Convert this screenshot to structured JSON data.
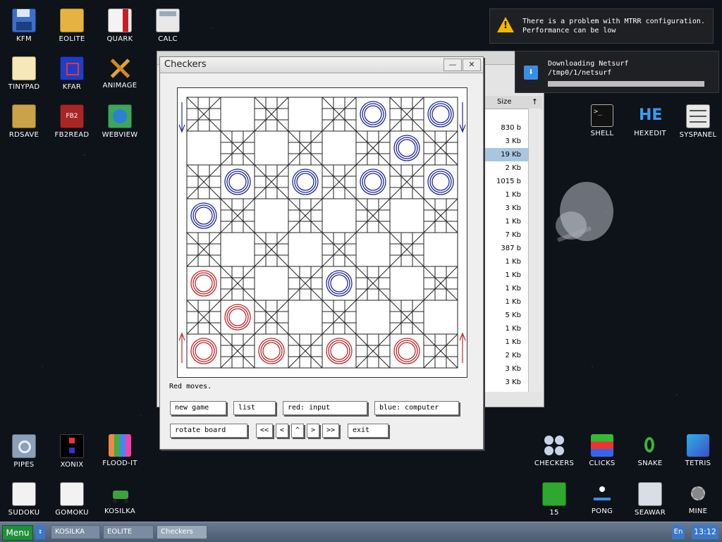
{
  "desktop": {
    "icons_left": [
      {
        "label": "KFM",
        "icon": "floppy-icon"
      },
      {
        "label": "EOLITE",
        "icon": "folder-icon"
      },
      {
        "label": "QUARK",
        "icon": "book-icon"
      },
      {
        "label": "CALC",
        "icon": "calculator-icon"
      },
      {
        "label": "TINYPAD",
        "icon": "notepad-icon"
      },
      {
        "label": "KFAR",
        "icon": "archive-icon"
      },
      {
        "label": "ANIMAGE",
        "icon": "paint-icon"
      },
      {
        "label": "RDSAVE",
        "icon": "disk-save-icon"
      },
      {
        "label": "FB2READ",
        "icon": "fb2-book-icon"
      },
      {
        "label": "WEBVIEW",
        "icon": "globe-icon"
      },
      {
        "label": "PIPES",
        "icon": "pipes-icon"
      },
      {
        "label": "XONIX",
        "icon": "xonix-icon"
      },
      {
        "label": "FLOOD-IT",
        "icon": "flood-icon"
      },
      {
        "label": "SUDOKU",
        "icon": "sudoku-icon"
      },
      {
        "label": "GOMOKU",
        "icon": "gomoku-icon"
      },
      {
        "label": "KOSILKA",
        "icon": "lawnmower-icon"
      }
    ],
    "icons_right": [
      {
        "label": "SHELL",
        "icon": "terminal-icon"
      },
      {
        "label": "HEXEDIT",
        "icon": "hex-icon"
      },
      {
        "label": "SYSPANEL",
        "icon": "sliders-icon"
      },
      {
        "label": "CHECKERS",
        "icon": "checkers-icon"
      },
      {
        "label": "CLICKS",
        "icon": "blocks-icon"
      },
      {
        "label": "SNAKE",
        "icon": "snake-icon"
      },
      {
        "label": "TETRIS",
        "icon": "tetris-icon"
      },
      {
        "label": "15",
        "icon": "fifteen-icon"
      },
      {
        "label": "PONG",
        "icon": "pong-icon"
      },
      {
        "label": "SEAWAR",
        "icon": "ship-icon"
      },
      {
        "label": "MINE",
        "icon": "mine-icon"
      }
    ]
  },
  "file_manager": {
    "size_header": "Size",
    "sizes": [
      "830 b",
      "3 Kb",
      "19 Kb",
      "2 Kb",
      "1015 b",
      "1 Kb",
      "3 Kb",
      "1 Kb",
      "7 Kb",
      "387 b",
      "1 Kb",
      "1 Kb",
      "1 Kb",
      "1 Kb",
      "5 Kb",
      "1 Kb",
      "1 Kb",
      "2 Kb",
      "3 Kb",
      "3 Kb"
    ],
    "selected_index": 2
  },
  "checkers": {
    "title": "Checkers",
    "status": "Red moves.",
    "buttons": {
      "new_game": "new game",
      "list": "list",
      "red": "red: input",
      "blue": "blue: computer",
      "rotate": "rotate board",
      "first": "<<",
      "prev": "<",
      "up": "^",
      "next": ">",
      "last": ">>",
      "exit": "exit"
    },
    "blue_pieces": [
      [
        0,
        5
      ],
      [
        0,
        7
      ],
      [
        1,
        6
      ],
      [
        2,
        1
      ],
      [
        2,
        3
      ],
      [
        2,
        5
      ],
      [
        2,
        7
      ],
      [
        3,
        0
      ],
      [
        5,
        4
      ]
    ],
    "red_pieces": [
      [
        5,
        0
      ],
      [
        6,
        1
      ],
      [
        7,
        0
      ],
      [
        7,
        2
      ],
      [
        7,
        4
      ],
      [
        7,
        6
      ]
    ],
    "colors": {
      "red": "#c0282a",
      "blue": "#1f2a9a",
      "grid": "#222222"
    }
  },
  "notifications": {
    "mtrr": {
      "line1": "There is a problem with MTRR configuration.",
      "line2": "Performance can be low"
    },
    "download": {
      "title": "Downloading Netsurf",
      "path": "/tmp0/1/netsurf",
      "progress": 0.0
    }
  },
  "taskbar": {
    "menu": "Menu",
    "tasks": [
      "KOSILKA",
      "EOLITE",
      "Checkers"
    ],
    "active_task": "Checkers",
    "lang": "En",
    "clock": "13:12"
  }
}
